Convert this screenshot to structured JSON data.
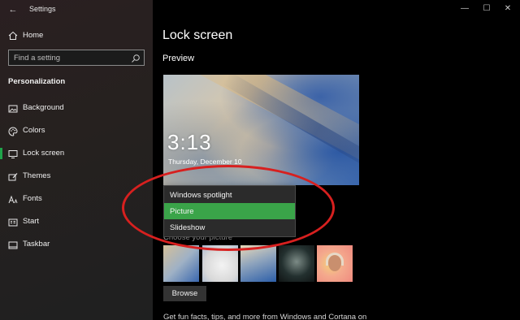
{
  "window": {
    "app_title": "Settings",
    "back_glyph": "←",
    "minimize_glyph": "—",
    "maximize_glyph": "☐",
    "close_glyph": "✕"
  },
  "sidebar": {
    "home_label": "Home",
    "search_placeholder": "Find a setting",
    "section_heading": "Personalization",
    "items": [
      {
        "label": "Background",
        "icon": "picture-icon",
        "active": false
      },
      {
        "label": "Colors",
        "icon": "palette-icon",
        "active": false
      },
      {
        "label": "Lock screen",
        "icon": "monitor-lock-icon",
        "active": true
      },
      {
        "label": "Themes",
        "icon": "brush-icon",
        "active": false
      },
      {
        "label": "Fonts",
        "icon": "font-icon",
        "active": false
      },
      {
        "label": "Start",
        "icon": "start-icon",
        "active": false
      },
      {
        "label": "Taskbar",
        "icon": "taskbar-icon",
        "active": false
      }
    ],
    "accent_color": "#1fa34a"
  },
  "main": {
    "page_title": "Lock screen",
    "preview_heading": "Preview",
    "preview": {
      "time": "3:13",
      "date": "Thursday, December 10"
    },
    "background_dropdown": {
      "options": [
        "Windows spotlight",
        "Picture",
        "Slideshow"
      ],
      "selected": "Picture",
      "selected_color": "#3aa449"
    },
    "choose_picture_label": "Choose your picture",
    "browse_label": "Browse",
    "footer_text": "Get fun facts, tips, and more from Windows and Cortana on"
  },
  "annotation": {
    "color": "#d7201f"
  }
}
